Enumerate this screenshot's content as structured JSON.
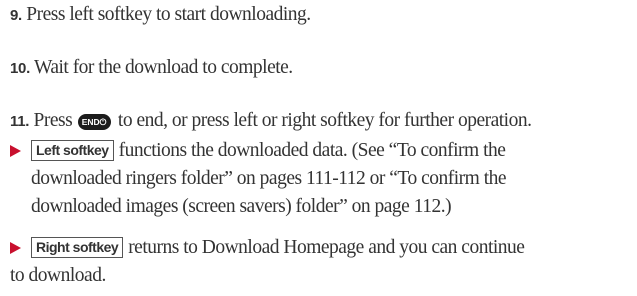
{
  "steps": [
    {
      "num": "9.",
      "text": "Press left softkey to start downloading."
    },
    {
      "num": "10.",
      "text": "Wait for the download to complete."
    },
    {
      "num": "11.",
      "pre": "Press",
      "key": "END⏻",
      "post": "to end, or press left or right softkey for further operation."
    }
  ],
  "bullets": [
    {
      "key": "Left softkey",
      "lines": [
        "functions the downloaded data. (See “To confirm the",
        "downloaded ringers folder” on pages 111-112 or “To confirm the",
        "downloaded images (screen savers) folder” on page 112.)"
      ]
    },
    {
      "key": "Right softkey",
      "lines": [
        "returns to Download Homepage and you can continue",
        "to download."
      ]
    }
  ],
  "colors": {
    "arrow": "#c8102e",
    "text": "#333333",
    "key_bg": "#1c1c1c"
  }
}
